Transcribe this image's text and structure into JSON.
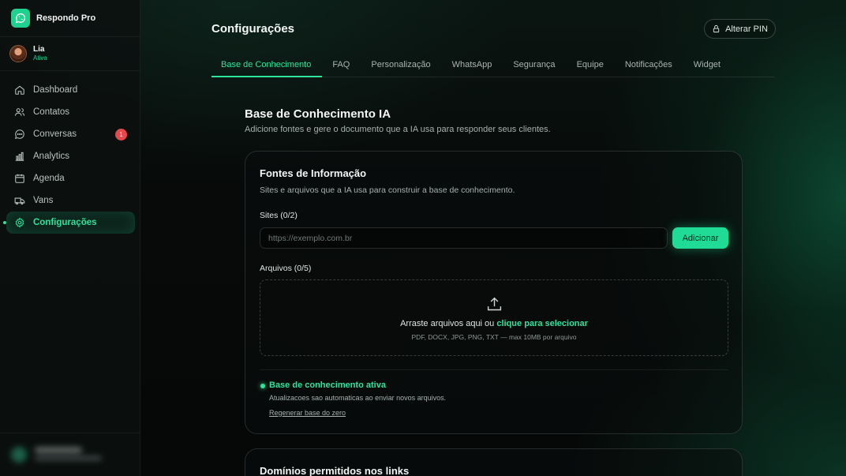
{
  "app": {
    "name": "Respondo Pro"
  },
  "user": {
    "name": "Lia",
    "status": "Ativa"
  },
  "sidebar": {
    "items": [
      {
        "label": "Dashboard",
        "icon": "home-icon"
      },
      {
        "label": "Contatos",
        "icon": "users-icon"
      },
      {
        "label": "Conversas",
        "icon": "chat-icon",
        "badge": "1"
      },
      {
        "label": "Analytics",
        "icon": "bar-chart-icon"
      },
      {
        "label": "Agenda",
        "icon": "calendar-icon"
      },
      {
        "label": "Vans",
        "icon": "van-icon"
      },
      {
        "label": "Configurações",
        "icon": "gear-icon",
        "active": true
      }
    ]
  },
  "header": {
    "title": "Configurações",
    "pin_button": "Alterar PIN"
  },
  "tabs": [
    "Base de Conhecimento",
    "FAQ",
    "Personalização",
    "WhatsApp",
    "Segurança",
    "Equipe",
    "Notificações",
    "Widget"
  ],
  "section": {
    "title": "Base de Conhecimento IA",
    "subtitle": "Adicione fontes e gere o documento que a IA usa para responder seus clientes."
  },
  "sources_card": {
    "title": "Fontes de Informação",
    "subtitle": "Sites e arquivos que a IA usa para construir a base de conhecimento.",
    "sites_label": "Sites (0/2)",
    "site_placeholder": "https://exemplo.com.br",
    "add_button": "Adicionar",
    "files_label": "Arquivos (0/5)",
    "drop_text": "Arraste arquivos aqui ou",
    "drop_link": "clique para selecionar",
    "drop_hint": "PDF, DOCX, JPG, PNG, TXT — max 10MB por arquivo",
    "status_title": "Base de conhecimento ativa",
    "status_subtitle": "Atualizacoes sao automaticas ao enviar novos arquivos.",
    "regenerate_link": "Regenerar base do zero"
  },
  "domains_card": {
    "title": "Domínios permitidos nos links"
  },
  "colors": {
    "accent": "#2ee39c",
    "button": "#1fdb96",
    "badge": "#e5484d",
    "background": "#070a09"
  }
}
